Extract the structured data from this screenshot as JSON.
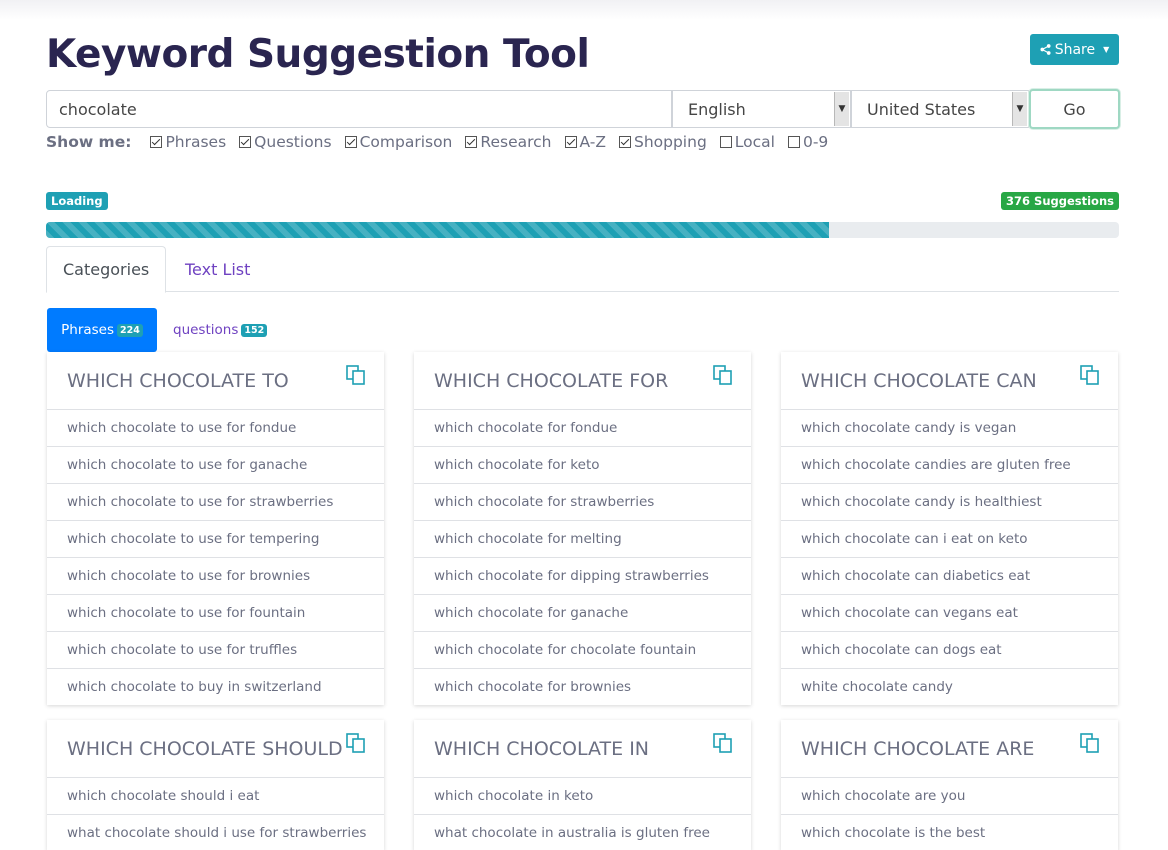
{
  "header": {
    "title": "Keyword Suggestion Tool",
    "share_label": "Share"
  },
  "search": {
    "query": "chocolate",
    "language": "English",
    "country": "United States",
    "go_label": "Go"
  },
  "show_me": {
    "label": "Show me:",
    "options": [
      {
        "label": "Phrases",
        "checked": true
      },
      {
        "label": "Questions",
        "checked": true
      },
      {
        "label": "Comparison",
        "checked": true
      },
      {
        "label": "Research",
        "checked": true
      },
      {
        "label": "A-Z",
        "checked": true
      },
      {
        "label": "Shopping",
        "checked": true
      },
      {
        "label": "Local",
        "checked": false
      },
      {
        "label": "0-9",
        "checked": false
      }
    ]
  },
  "status": {
    "loading_label": "Loading",
    "suggestions_label": "376 Suggestions",
    "progress_percent": 73
  },
  "tabs": [
    {
      "label": "Categories",
      "active": true
    },
    {
      "label": "Text List",
      "active": false
    }
  ],
  "pills": [
    {
      "label": "Phrases",
      "count": "224",
      "active": true
    },
    {
      "label": "questions",
      "count": "152",
      "active": false
    }
  ],
  "cards": [
    {
      "title": "WHICH CHOCOLATE TO",
      "items": [
        "which chocolate to use for fondue",
        "which chocolate to use for ganache",
        "which chocolate to use for strawberries",
        "which chocolate to use for tempering",
        "which chocolate to use for brownies",
        "which chocolate to use for fountain",
        "which chocolate to use for truffles",
        "which chocolate to buy in switzerland"
      ]
    },
    {
      "title": "WHICH CHOCOLATE FOR",
      "items": [
        "which chocolate for fondue",
        "which chocolate for keto",
        "which chocolate for strawberries",
        "which chocolate for melting",
        "which chocolate for dipping strawberries",
        "which chocolate for ganache",
        "which chocolate for chocolate fountain",
        "which chocolate for brownies"
      ]
    },
    {
      "title": "WHICH CHOCOLATE CAN",
      "items": [
        "which chocolate candy is vegan",
        "which chocolate candies are gluten free",
        "which chocolate candy is healthiest",
        "which chocolate can i eat on keto",
        "which chocolate can diabetics eat",
        "which chocolate can vegans eat",
        "which chocolate can dogs eat",
        "white chocolate candy"
      ]
    },
    {
      "title": "WHICH CHOCOLATE SHOULD",
      "items": [
        "which chocolate should i eat",
        "what chocolate should i use for strawberries"
      ]
    },
    {
      "title": "WHICH CHOCOLATE IN",
      "items": [
        "which chocolate in keto",
        "what chocolate in australia is gluten free"
      ]
    },
    {
      "title": "WHICH CHOCOLATE ARE",
      "items": [
        "which chocolate are you",
        "which chocolate is the best"
      ]
    }
  ],
  "colors": {
    "title": "#2a2550",
    "accent_teal": "#1ea0b4",
    "success_green": "#28a745",
    "primary_blue": "#007bff",
    "link_purple": "#6f42c1"
  }
}
